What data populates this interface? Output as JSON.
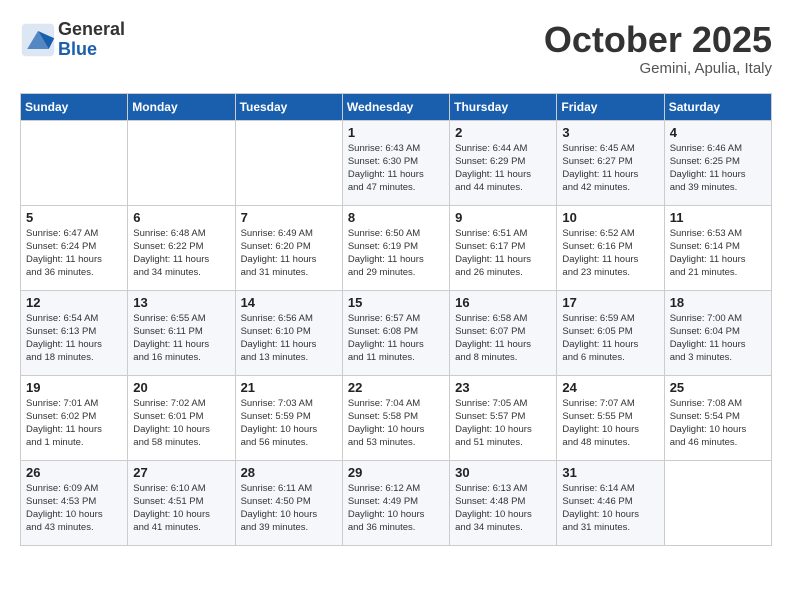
{
  "header": {
    "logo_general": "General",
    "logo_blue": "Blue",
    "month_title": "October 2025",
    "location": "Gemini, Apulia, Italy"
  },
  "days_of_week": [
    "Sunday",
    "Monday",
    "Tuesday",
    "Wednesday",
    "Thursday",
    "Friday",
    "Saturday"
  ],
  "weeks": [
    [
      {
        "num": "",
        "info": ""
      },
      {
        "num": "",
        "info": ""
      },
      {
        "num": "",
        "info": ""
      },
      {
        "num": "1",
        "info": "Sunrise: 6:43 AM\nSunset: 6:30 PM\nDaylight: 11 hours\nand 47 minutes."
      },
      {
        "num": "2",
        "info": "Sunrise: 6:44 AM\nSunset: 6:29 PM\nDaylight: 11 hours\nand 44 minutes."
      },
      {
        "num": "3",
        "info": "Sunrise: 6:45 AM\nSunset: 6:27 PM\nDaylight: 11 hours\nand 42 minutes."
      },
      {
        "num": "4",
        "info": "Sunrise: 6:46 AM\nSunset: 6:25 PM\nDaylight: 11 hours\nand 39 minutes."
      }
    ],
    [
      {
        "num": "5",
        "info": "Sunrise: 6:47 AM\nSunset: 6:24 PM\nDaylight: 11 hours\nand 36 minutes."
      },
      {
        "num": "6",
        "info": "Sunrise: 6:48 AM\nSunset: 6:22 PM\nDaylight: 11 hours\nand 34 minutes."
      },
      {
        "num": "7",
        "info": "Sunrise: 6:49 AM\nSunset: 6:20 PM\nDaylight: 11 hours\nand 31 minutes."
      },
      {
        "num": "8",
        "info": "Sunrise: 6:50 AM\nSunset: 6:19 PM\nDaylight: 11 hours\nand 29 minutes."
      },
      {
        "num": "9",
        "info": "Sunrise: 6:51 AM\nSunset: 6:17 PM\nDaylight: 11 hours\nand 26 minutes."
      },
      {
        "num": "10",
        "info": "Sunrise: 6:52 AM\nSunset: 6:16 PM\nDaylight: 11 hours\nand 23 minutes."
      },
      {
        "num": "11",
        "info": "Sunrise: 6:53 AM\nSunset: 6:14 PM\nDaylight: 11 hours\nand 21 minutes."
      }
    ],
    [
      {
        "num": "12",
        "info": "Sunrise: 6:54 AM\nSunset: 6:13 PM\nDaylight: 11 hours\nand 18 minutes."
      },
      {
        "num": "13",
        "info": "Sunrise: 6:55 AM\nSunset: 6:11 PM\nDaylight: 11 hours\nand 16 minutes."
      },
      {
        "num": "14",
        "info": "Sunrise: 6:56 AM\nSunset: 6:10 PM\nDaylight: 11 hours\nand 13 minutes."
      },
      {
        "num": "15",
        "info": "Sunrise: 6:57 AM\nSunset: 6:08 PM\nDaylight: 11 hours\nand 11 minutes."
      },
      {
        "num": "16",
        "info": "Sunrise: 6:58 AM\nSunset: 6:07 PM\nDaylight: 11 hours\nand 8 minutes."
      },
      {
        "num": "17",
        "info": "Sunrise: 6:59 AM\nSunset: 6:05 PM\nDaylight: 11 hours\nand 6 minutes."
      },
      {
        "num": "18",
        "info": "Sunrise: 7:00 AM\nSunset: 6:04 PM\nDaylight: 11 hours\nand 3 minutes."
      }
    ],
    [
      {
        "num": "19",
        "info": "Sunrise: 7:01 AM\nSunset: 6:02 PM\nDaylight: 11 hours\nand 1 minute."
      },
      {
        "num": "20",
        "info": "Sunrise: 7:02 AM\nSunset: 6:01 PM\nDaylight: 10 hours\nand 58 minutes."
      },
      {
        "num": "21",
        "info": "Sunrise: 7:03 AM\nSunset: 5:59 PM\nDaylight: 10 hours\nand 56 minutes."
      },
      {
        "num": "22",
        "info": "Sunrise: 7:04 AM\nSunset: 5:58 PM\nDaylight: 10 hours\nand 53 minutes."
      },
      {
        "num": "23",
        "info": "Sunrise: 7:05 AM\nSunset: 5:57 PM\nDaylight: 10 hours\nand 51 minutes."
      },
      {
        "num": "24",
        "info": "Sunrise: 7:07 AM\nSunset: 5:55 PM\nDaylight: 10 hours\nand 48 minutes."
      },
      {
        "num": "25",
        "info": "Sunrise: 7:08 AM\nSunset: 5:54 PM\nDaylight: 10 hours\nand 46 minutes."
      }
    ],
    [
      {
        "num": "26",
        "info": "Sunrise: 6:09 AM\nSunset: 4:53 PM\nDaylight: 10 hours\nand 43 minutes."
      },
      {
        "num": "27",
        "info": "Sunrise: 6:10 AM\nSunset: 4:51 PM\nDaylight: 10 hours\nand 41 minutes."
      },
      {
        "num": "28",
        "info": "Sunrise: 6:11 AM\nSunset: 4:50 PM\nDaylight: 10 hours\nand 39 minutes."
      },
      {
        "num": "29",
        "info": "Sunrise: 6:12 AM\nSunset: 4:49 PM\nDaylight: 10 hours\nand 36 minutes."
      },
      {
        "num": "30",
        "info": "Sunrise: 6:13 AM\nSunset: 4:48 PM\nDaylight: 10 hours\nand 34 minutes."
      },
      {
        "num": "31",
        "info": "Sunrise: 6:14 AM\nSunset: 4:46 PM\nDaylight: 10 hours\nand 31 minutes."
      },
      {
        "num": "",
        "info": ""
      }
    ]
  ]
}
